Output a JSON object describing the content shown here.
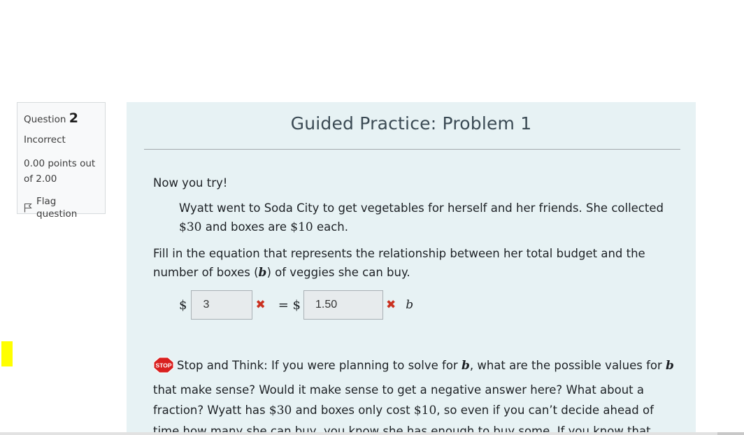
{
  "question_info": {
    "label": "Question",
    "number": "2",
    "state": "Incorrect",
    "grade_line1": "0.00 points out",
    "grade_line2": "of 2.00",
    "flag_label": "Flag question"
  },
  "panel": {
    "title": "Guided Practice: Problem 1",
    "intro": "Now you try!",
    "story_part1": "Wyatt went to Soda City to get vegetables for herself and her friends. She collected",
    "story_amount1": "$30",
    "story_part2": "and boxes are",
    "story_amount2": "$10",
    "story_part3": "each.",
    "instruction_part1": "Fill in the equation that represents the relationship between her total budget and the",
    "instruction_part2": "number of boxes (",
    "instruction_var": "b",
    "instruction_part3": ") of veggies she can buy.",
    "equation": {
      "dollar1": "$",
      "answer1": "3",
      "equals_dollar": "= $",
      "answer2": "1.50",
      "variable": "b",
      "wrong_mark": "✖"
    },
    "stop_badge": "STOP",
    "stop_line1_a": "Stop and Think: If you were planning to solve for",
    "stop_var1": "b",
    "stop_line1_b": ", what are the possible values for",
    "stop_var2": "b",
    "stop_line2": "that make sense? Would it make sense to get a negative answer here? What about a",
    "stop_line3_a": "fraction? Wyatt has",
    "stop_amount1": "$30",
    "stop_line3_b": "and boxes only cost",
    "stop_amount2": "$10",
    "stop_line3_c": ", so even if you can’t decide ahead of",
    "stop_line4": "time how many she can buy, you know she has enough to buy some. If you know that"
  },
  "colors": {
    "panel_bg": "#e7f2f4",
    "incorrect_red": "#ca3120",
    "highlight_yellow": "#ffff00"
  }
}
